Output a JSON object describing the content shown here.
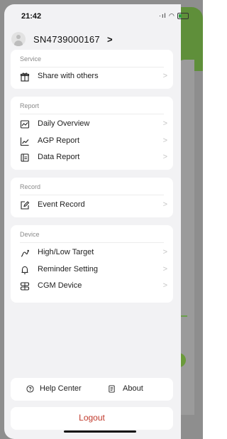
{
  "status_bar": {
    "time": "21:42"
  },
  "profile": {
    "serial": "SN4739000167",
    "chevron": ">"
  },
  "sections": {
    "service": {
      "title": "Service",
      "items": [
        {
          "label": "Share with others",
          "icon": "gift-icon"
        }
      ]
    },
    "report": {
      "title": "Report",
      "items": [
        {
          "label": "Daily Overview",
          "icon": "chart-window-icon"
        },
        {
          "label": "AGP Report",
          "icon": "line-chart-icon"
        },
        {
          "label": "Data Report",
          "icon": "document-icon"
        }
      ]
    },
    "record": {
      "title": "Record",
      "items": [
        {
          "label": "Event Record",
          "icon": "edit-icon"
        }
      ]
    },
    "device": {
      "title": "Device",
      "items": [
        {
          "label": "High/Low Target",
          "icon": "target-curve-icon"
        },
        {
          "label": "Reminder Setting",
          "icon": "bell-icon"
        },
        {
          "label": "CGM Device",
          "icon": "device-grid-icon"
        }
      ]
    }
  },
  "footer": {
    "help_center": "Help Center",
    "about": "About",
    "logout": "Logout"
  },
  "colors": {
    "logout": "#c0392b",
    "accent_green": "#5f8f3a"
  }
}
